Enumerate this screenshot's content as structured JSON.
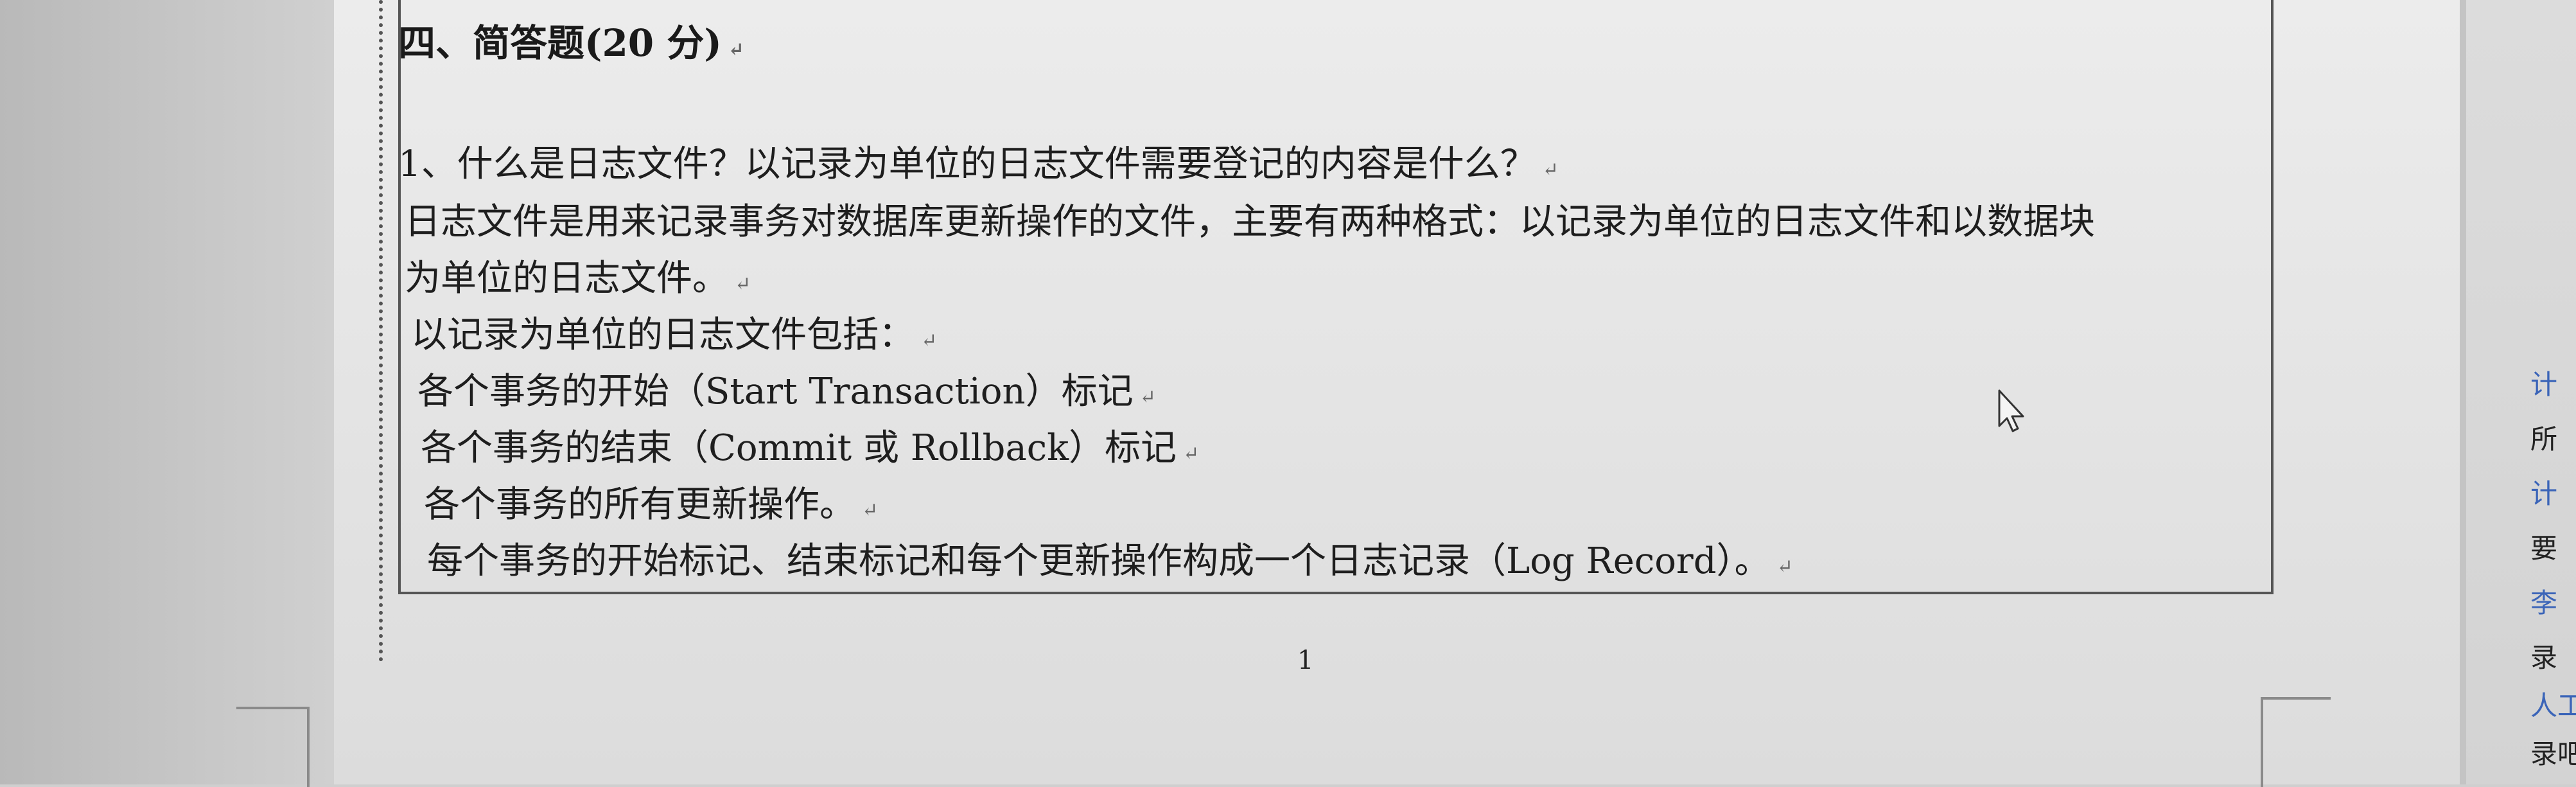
{
  "document": {
    "heading": "四、简答题(20 分)",
    "lines": [
      "1、什么是日志文件？以记录为单位的日志文件需要登记的内容是什么？",
      "日志文件是用来记录事务对数据库更新操作的文件，主要有两种格式：以记录为单位的日志文件和以数据块",
      "为单位的日志文件。",
      "以记录为单位的日志文件包括：",
      "各个事务的开始（Start Transaction）标记",
      "各个事务的结束（Commit 或 Rollback）标记",
      "各个事务的所有更新操作。",
      "每个事务的开始标记、结束标记和每个更新操作构成一个日志记录（Log Record）。"
    ],
    "paragraph_mark": "↵",
    "page_number": "1"
  },
  "side_panel": {
    "items": [
      {
        "text": "计",
        "color": "#3a64b8"
      },
      {
        "text": "所",
        "color": "#222222"
      },
      {
        "text": "计",
        "color": "#3a64b8"
      },
      {
        "text": "要",
        "color": "#222222"
      },
      {
        "text": "李",
        "color": "#3a64b8"
      },
      {
        "text": "录",
        "color": "#222222"
      },
      {
        "text": "人工",
        "color": "#3a64b8"
      },
      {
        "text": "录吧",
        "color": "#222222"
      }
    ]
  },
  "colors": {
    "text": "#1e1e1e",
    "link_blue": "#3a64b8",
    "frame": "#555555"
  }
}
